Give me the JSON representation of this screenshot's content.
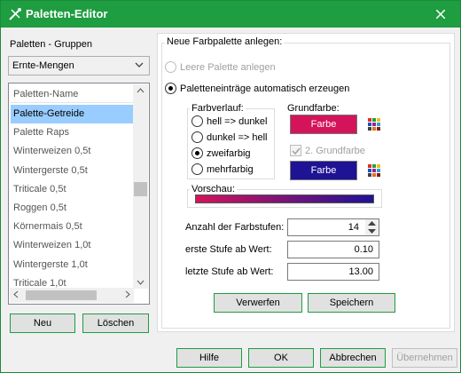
{
  "window": {
    "title": "Paletten-Editor"
  },
  "left": {
    "group_label": "Paletten - Gruppen",
    "group_combo_value": "Ernte-Mengen",
    "list_header": "Paletten-Name",
    "items": [
      "Palette-Getreide",
      "Palette Raps",
      "Winterweizen 0,5t",
      "Wintergerste 0,5t",
      "Triticale 0,5t",
      "Roggen 0,5t",
      "Körnermais 0,5t",
      "Winterweizen 1,0t",
      "Wintergerste 1,0t",
      "Triticale 1,0t"
    ],
    "selected_index": 0,
    "new_button": "Neu",
    "delete_button": "Löschen"
  },
  "panel": {
    "title": "Neue Farbpalette anlegen:",
    "radio_empty": "Leere Palette anlegen",
    "radio_auto": "Paletteneinträge automatisch erzeugen",
    "gradient_title": "Farbverlauf:",
    "gradients": [
      "hell => dunkel",
      "dunkel => hell",
      "zweifarbig",
      "mehrfarbig"
    ],
    "gradient_selected": 2,
    "basecolor_title": "Grundfarbe:",
    "color_button": "Farbe",
    "second_color_label": "2. Grundfarbe",
    "color1": "#d4145a",
    "color2": "#1e1395",
    "preview_title": "Vorschau:",
    "steps_label": "Anzahl der Farbstufen:",
    "steps_value": "14",
    "first_label": "erste Stufe ab Wert:",
    "first_value": "0.10",
    "last_label": "letzte Stufe ab Wert:",
    "last_value": "13.00",
    "discard_button": "Verwerfen",
    "save_button": "Speichern"
  },
  "footer": {
    "help": "Hilfe",
    "ok": "OK",
    "cancel": "Abbrechen",
    "apply": "Übernehmen"
  }
}
